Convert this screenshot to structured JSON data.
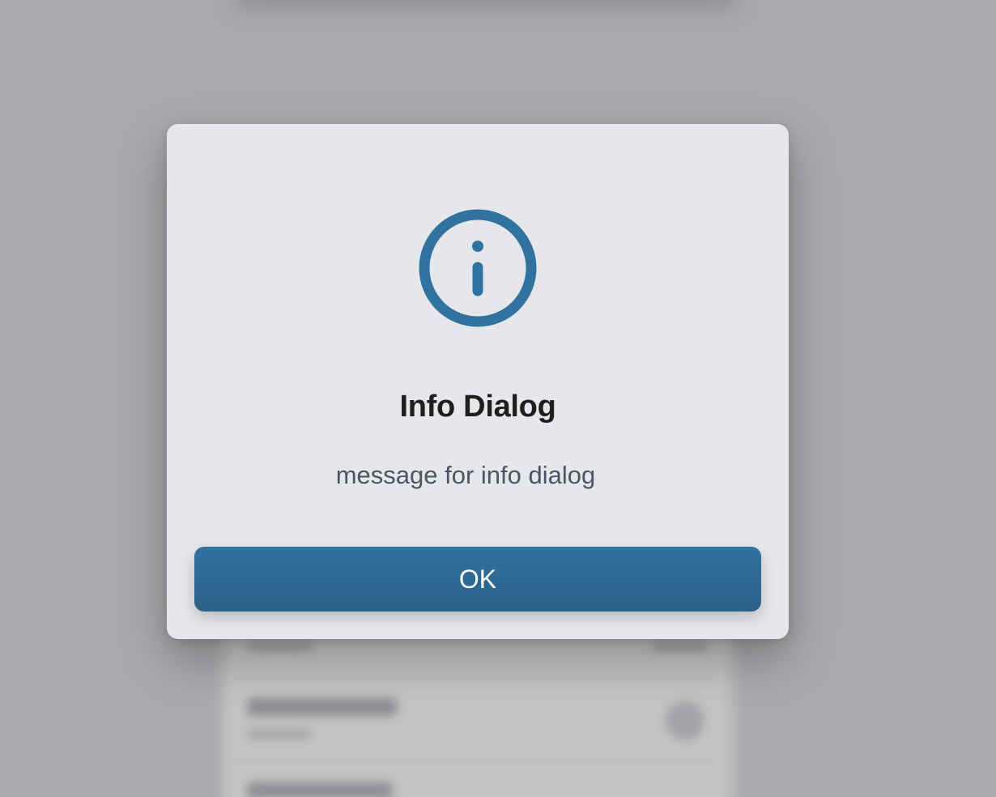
{
  "dialog": {
    "icon": "info-icon",
    "title": "Info Dialog",
    "message": "message for info dialog",
    "ok_label": "OK"
  },
  "colors": {
    "accent": "#3172a0",
    "dialog_background": "#e6e7ea",
    "overlay": "#a9aaad",
    "title_text": "#1e1e1e",
    "message_text": "#4b5563"
  }
}
